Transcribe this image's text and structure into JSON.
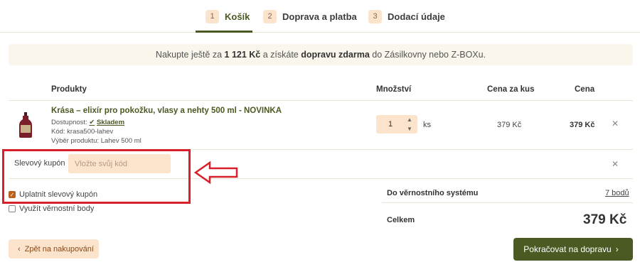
{
  "steps": [
    {
      "num": "1",
      "label": "Košík"
    },
    {
      "num": "2",
      "label": "Doprava a platba"
    },
    {
      "num": "3",
      "label": "Dodací údaje"
    }
  ],
  "banner": {
    "prefix": "Nakupte ještě za ",
    "amount": "1 121 Kč",
    "middle": " a získáte ",
    "free": "dopravu zdarma",
    "suffix": " do Zásilkovny nebo Z-BOXu."
  },
  "table": {
    "headers": {
      "products": "Produkty",
      "quantity": "Množství",
      "unit_price": "Cena za kus",
      "price": "Cena"
    }
  },
  "product": {
    "name": "Krása – elixír pro pokožku, vlasy a nehty 500 ml - NOVINKA",
    "availability_label": "Dostupnost:",
    "availability_value": "Skladem",
    "code": "Kód: krasa500-lahev",
    "variant": "Výběr produktu: Lahev 500 ml",
    "quantity": "1",
    "unit": "ks",
    "unit_price": "379 Kč",
    "total": "379 Kč"
  },
  "coupon": {
    "label": "Slevový kupón",
    "placeholder": "Vložte svůj kód",
    "apply_label": "Uplatnit slevový kupón",
    "apply_checked": true,
    "points_label": "Využít věrnostní body",
    "points_checked": false
  },
  "summary": {
    "loyalty_label": "Do věrnostního systému",
    "loyalty_value": "7 bodů",
    "total_label": "Celkem",
    "total_value": "379 Kč"
  },
  "buttons": {
    "back": "Zpět na nakupování",
    "next": "Pokračovat na dopravu"
  },
  "colors": {
    "accent_green": "#4a5a22",
    "peach": "#fbe3cc",
    "highlight_red": "#d8202a"
  }
}
